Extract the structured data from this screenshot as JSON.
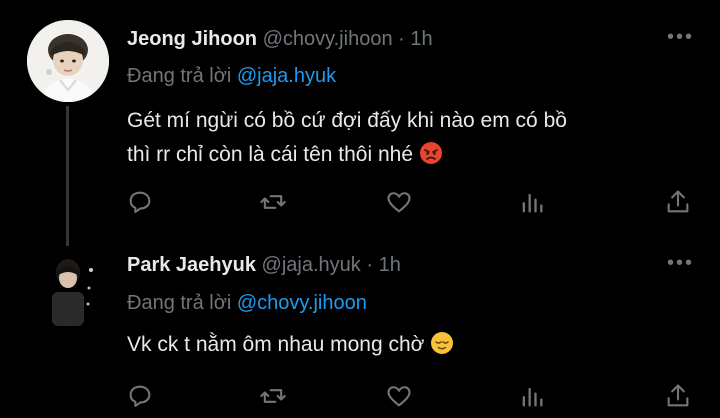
{
  "tweets": [
    {
      "name": "Jeong Jihoon",
      "handle": "@chovy.jihoon",
      "dot": "·",
      "time": "1h",
      "reply_prefix": "Đang trả lời",
      "reply_to": "@jaja.hyuk",
      "text_line1": "Gét mí ngừi có bồ cứ đợi đấy khi nào em có bồ",
      "text_line2": "thì rr chỉ còn là cái tên thôi nhé",
      "emoji": "angry-face",
      "more": "•••"
    },
    {
      "name": "Park Jaehyuk",
      "handle": "@jaja.hyuk",
      "dot": "·",
      "time": "1h",
      "reply_prefix": "Đang trả lời",
      "reply_to": "@chovy.jihoon",
      "text_line1": "Vk ck t nằm ôm nhau mong chờ",
      "emoji": "relieved-face",
      "more": "•••"
    }
  ],
  "colors": {
    "background": "#000000",
    "text": "#e7e9ea",
    "muted": "#71767b",
    "link": "#1d9bf0",
    "thread_line": "#333639"
  },
  "action_icons": [
    "reply-icon",
    "retweet-icon",
    "like-icon",
    "views-icon",
    "share-icon"
  ]
}
